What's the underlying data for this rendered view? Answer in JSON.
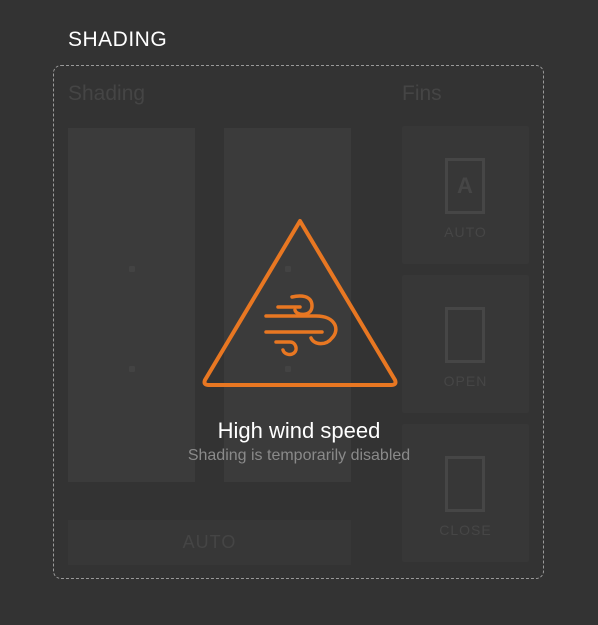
{
  "section_title": "SHADING",
  "shading": {
    "heading": "Shading",
    "auto_label": "AUTO"
  },
  "fins": {
    "heading": "Fins",
    "cards": [
      {
        "label": "AUTO",
        "icon": "fin-auto-icon",
        "glyph": "A"
      },
      {
        "label": "OPEN",
        "icon": "fin-open-icon",
        "glyph": ""
      },
      {
        "label": "CLOSE",
        "icon": "fin-close-icon",
        "glyph": ""
      }
    ]
  },
  "alert": {
    "icon": "wind-warning-icon",
    "title": "High wind speed",
    "subtitle": "Shading is temporarily disabled"
  },
  "colors": {
    "accent": "#e87722",
    "background": "#333333",
    "frame": "#9a9a9a"
  }
}
